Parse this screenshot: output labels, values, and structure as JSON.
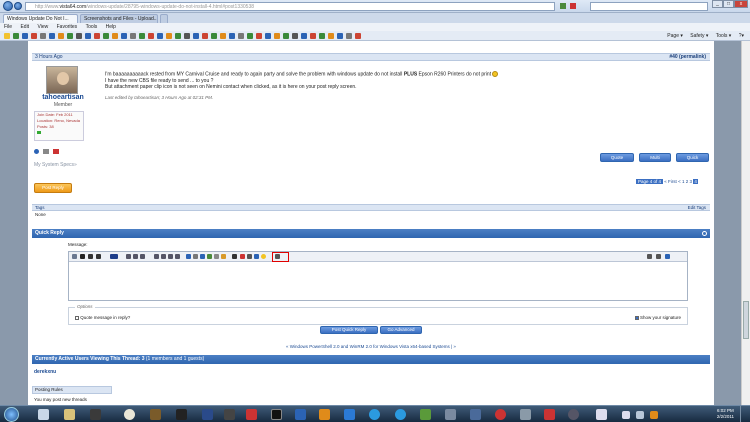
{
  "browser": {
    "url_prefix": "http://www.",
    "url_domain": "vista64.com",
    "url_rest": "/windows-update/28795-windows-update-do-not-install-4.html#post1330538",
    "tabs": [
      "Windows Update Do Not I...",
      "Screenshots and Files - Upload..."
    ],
    "menu": [
      "File",
      "Edit",
      "View",
      "Favorites",
      "Tools",
      "Help"
    ],
    "commands": [
      "Page ▾",
      "Safety ▾",
      "Tools ▾",
      "?▾"
    ]
  },
  "post": {
    "date": "3 Hours Ago",
    "number": "#40 (permalink)",
    "username": "tahoeartisan",
    "role": "Member",
    "join_date": "Join Date: Feb 2011",
    "location": "Location: Reno, Nevada",
    "posts": "Posts: 38",
    "specs_link": "My System Specs",
    "line1_a": "I'm baaaaaaaaaack rested from MY Carnival Cruise and ready to again party and solve the problem with windows update do not install ",
    "line1_b": "PLUS",
    "line1_c": " Epson R260 Printers do not print ",
    "line2": "I have the new CBS file ready to send ... to you ?",
    "line3": "But attachment paper clip icon is not seen on Nemini contact when clicked, as it is here on your post reply screen.",
    "edited": "Last edited by tahoeartisan; 3 Hours Ago at 02:31 PM.",
    "btn_quote": "Quote",
    "btn_multi": "Multi",
    "btn_quick": "Quick"
  },
  "post_reply": "Post Reply",
  "pagination": {
    "label": "Page 4 of 4",
    "first": "« First",
    "pages": [
      "<",
      "1",
      "2",
      "3",
      "4"
    ]
  },
  "tags": {
    "title": "Tags",
    "edit": "Edit Tags",
    "value": "None"
  },
  "quick_reply": {
    "title": "Quick Reply",
    "message_label": "Message:",
    "options_label": "Options",
    "quote_option": "Quote message in reply?",
    "signature_option": "Show your signature",
    "post_button": "Post Quick Reply",
    "advanced_button": "Go Advanced"
  },
  "thread_nav": "« Windows PowerShell 2.0 and WinRM 2.0 for Windows Vista x64-based Systems | »",
  "active_users": {
    "title": "Currently Active Users Viewing This Thread: 3",
    "detail": " (1 members and 1 guests)",
    "user": "derekxnu"
  },
  "posting_rules": {
    "title": "Posting Rules",
    "line": "You may post new threads",
    "may": "may"
  },
  "clock": {
    "time": "6:02 PM",
    "date": "2/2/2011"
  },
  "colors": {
    "accent": "#2f66b0",
    "post_reply": "#f5a623",
    "highlight": "#e00000"
  }
}
